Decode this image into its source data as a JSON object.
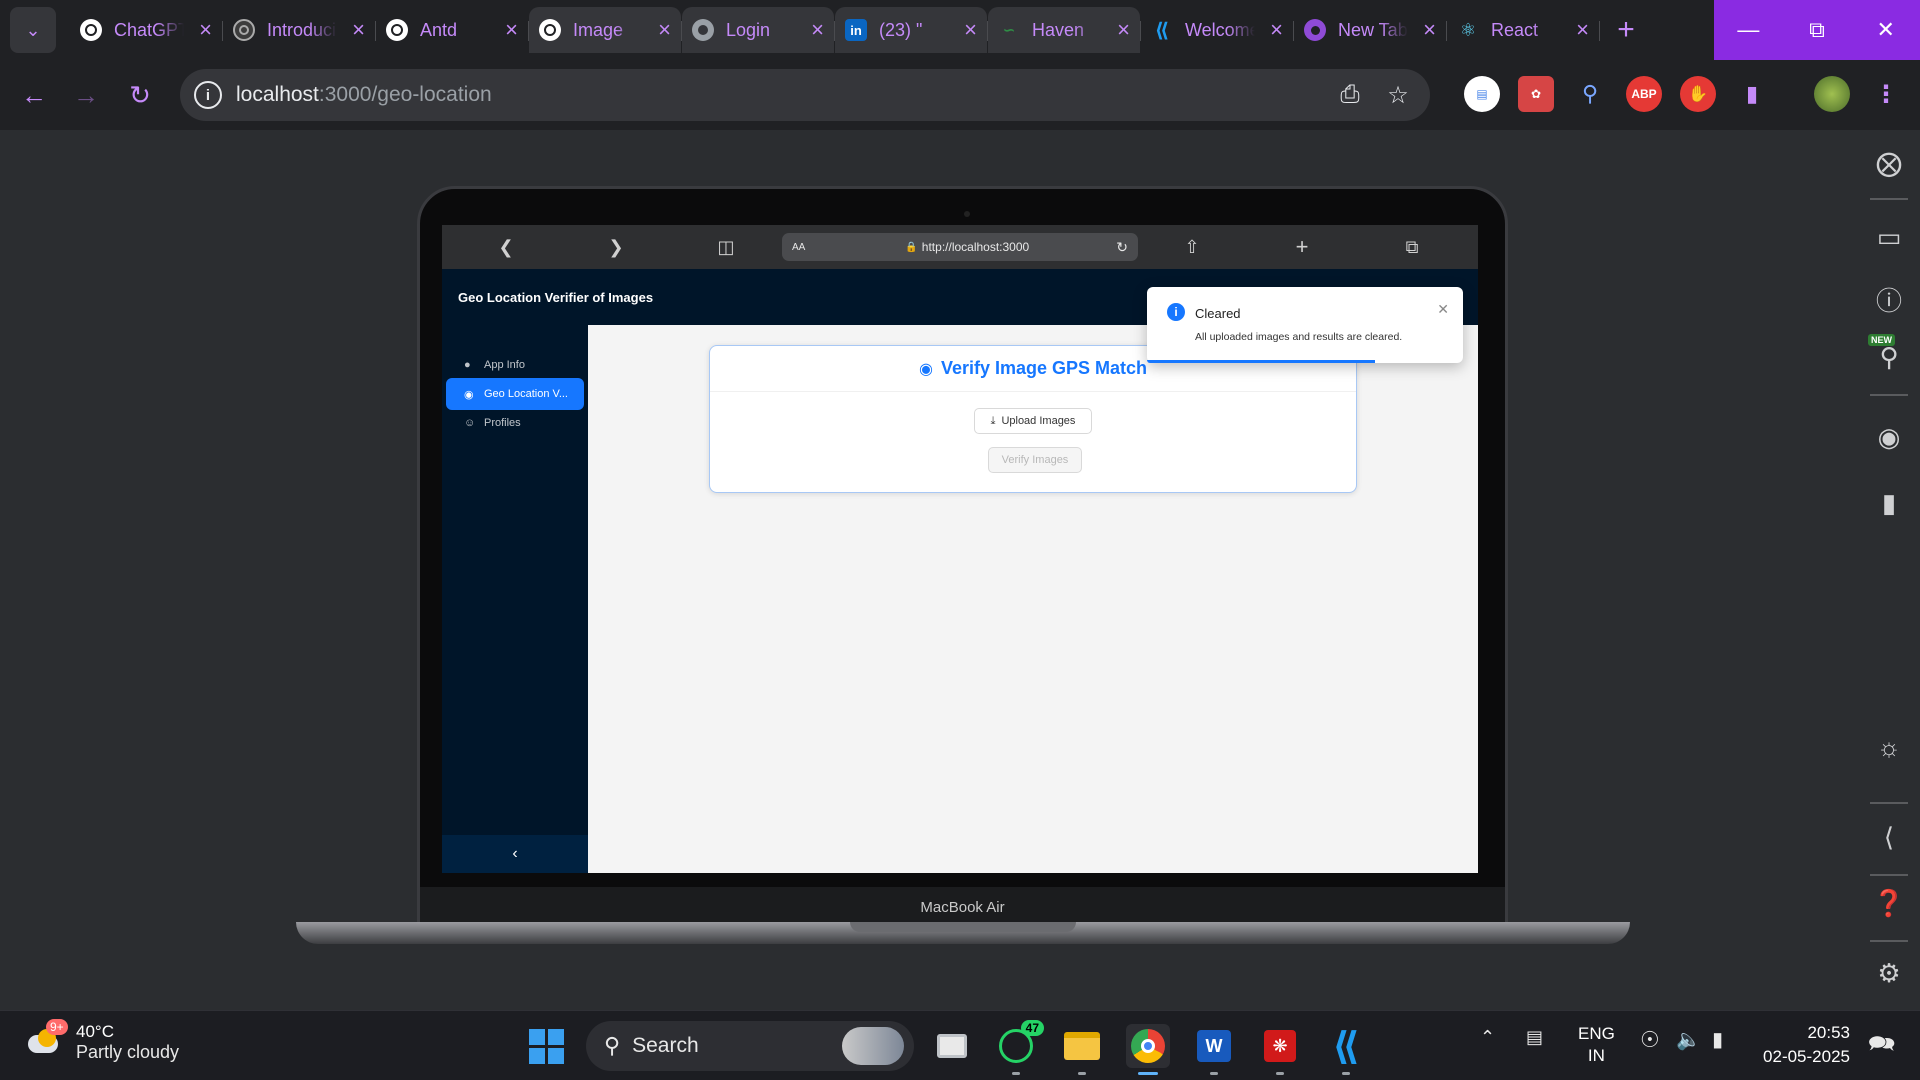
{
  "browser": {
    "tabs": [
      {
        "title": "ChatGPT",
        "favicon": "chatgpt-icon"
      },
      {
        "title": "Introducing",
        "favicon": "chatgpt-icon"
      },
      {
        "title": "Antd",
        "favicon": "chatgpt-icon"
      },
      {
        "title": "Image",
        "favicon": "chatgpt-icon"
      },
      {
        "title": "Login",
        "favicon": "globe-icon"
      },
      {
        "title": "(23) \"",
        "favicon": "linkedin-icon"
      },
      {
        "title": "Haven",
        "favicon": "gfg-icon"
      },
      {
        "title": "Welcome",
        "favicon": "vscode-icon"
      },
      {
        "title": "New Tab",
        "favicon": "chrome-icon"
      },
      {
        "title": "React",
        "favicon": "react-icon"
      }
    ],
    "url_host": "localhost",
    "url_path": ":3000/geo-location",
    "accent": "#c58af9",
    "window_accent": "#8a2be2"
  },
  "device": {
    "label": "MacBook Air",
    "safari_url_prefix": "AA",
    "safari_url": "http://localhost:3000"
  },
  "app": {
    "header_title": "Geo Location Verifier of Images",
    "menu": [
      {
        "label": "App Info"
      },
      {
        "label": "Geo Location V..."
      },
      {
        "label": "Profiles"
      }
    ],
    "card_title": "Verify Image GPS Match",
    "upload_label": "Upload Images",
    "verify_label": "Verify Images",
    "primary_color": "#1677ff"
  },
  "notification": {
    "title": "Cleared",
    "description": "All uploaded images and results are cleared."
  },
  "taskbar": {
    "weather_temp": "40°C",
    "weather_desc": "Partly cloudy",
    "weather_badge": "9+",
    "search_label": "Search",
    "whatsapp_badge": "47",
    "lang_line1": "ENG",
    "lang_line2": "IN",
    "time": "20:53",
    "date": "02-05-2025"
  },
  "right_panel": {
    "new_badge": "NEW"
  }
}
